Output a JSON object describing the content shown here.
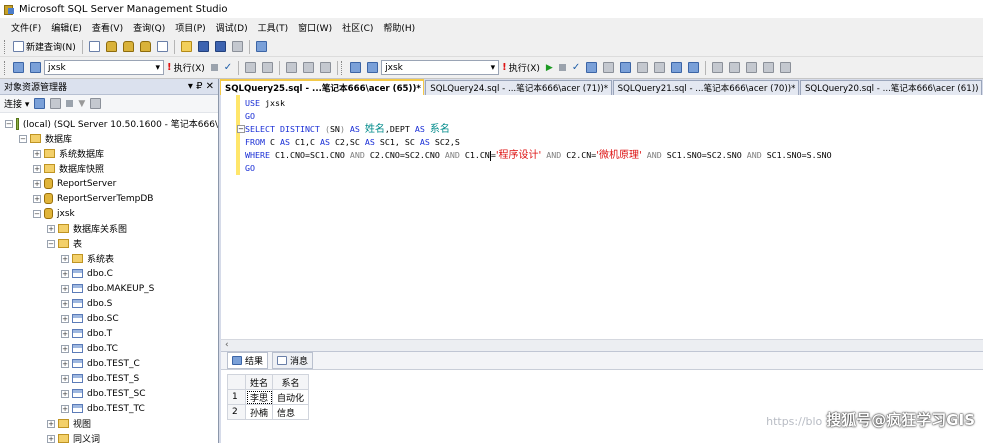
{
  "window": {
    "title": "Microsoft SQL Server Management Studio"
  },
  "menu": [
    "文件(F)",
    "编辑(E)",
    "查看(V)",
    "查询(Q)",
    "项目(P)",
    "调试(D)",
    "工具(T)",
    "窗口(W)",
    "社区(C)",
    "帮助(H)"
  ],
  "toolbar1": {
    "new_query": "新建查询(N)"
  },
  "toolbar2": {
    "db_left": "jxsk",
    "execute_left": "执行(X)",
    "db_right": "jxsk",
    "execute_right": "执行(X)"
  },
  "explorer": {
    "title": "对象资源管理器",
    "pin": "▾ ₽ ✕",
    "connect": "连接 ▾",
    "tree": [
      {
        "label": "(local) (SQL Server 10.50.1600 - 笔记本666\\",
        "indent": 0,
        "exp": "⊟",
        "icon": "server"
      },
      {
        "label": "数据库",
        "indent": 1,
        "exp": "⊟",
        "icon": "folder"
      },
      {
        "label": "系统数据库",
        "indent": 2,
        "exp": "⊞",
        "icon": "folder"
      },
      {
        "label": "数据库快照",
        "indent": 2,
        "exp": "⊞",
        "icon": "folder"
      },
      {
        "label": "ReportServer",
        "indent": 2,
        "exp": "⊞",
        "icon": "db"
      },
      {
        "label": "ReportServerTempDB",
        "indent": 2,
        "exp": "⊞",
        "icon": "db"
      },
      {
        "label": "jxsk",
        "indent": 2,
        "exp": "⊟",
        "icon": "db"
      },
      {
        "label": "数据库关系图",
        "indent": 3,
        "exp": "⊞",
        "icon": "folder"
      },
      {
        "label": "表",
        "indent": 3,
        "exp": "⊟",
        "icon": "folder"
      },
      {
        "label": "系统表",
        "indent": 4,
        "exp": "⊞",
        "icon": "folder"
      },
      {
        "label": "dbo.C",
        "indent": 4,
        "exp": "⊞",
        "icon": "table"
      },
      {
        "label": "dbo.MAKEUP_S",
        "indent": 4,
        "exp": "⊞",
        "icon": "table"
      },
      {
        "label": "dbo.S",
        "indent": 4,
        "exp": "⊞",
        "icon": "table"
      },
      {
        "label": "dbo.SC",
        "indent": 4,
        "exp": "⊞",
        "icon": "table"
      },
      {
        "label": "dbo.T",
        "indent": 4,
        "exp": "⊞",
        "icon": "table"
      },
      {
        "label": "dbo.TC",
        "indent": 4,
        "exp": "⊞",
        "icon": "table"
      },
      {
        "label": "dbo.TEST_C",
        "indent": 4,
        "exp": "⊞",
        "icon": "table"
      },
      {
        "label": "dbo.TEST_S",
        "indent": 4,
        "exp": "⊞",
        "icon": "table"
      },
      {
        "label": "dbo.TEST_SC",
        "indent": 4,
        "exp": "⊞",
        "icon": "table"
      },
      {
        "label": "dbo.TEST_TC",
        "indent": 4,
        "exp": "⊞",
        "icon": "table"
      },
      {
        "label": "视图",
        "indent": 3,
        "exp": "⊞",
        "icon": "folder"
      },
      {
        "label": "同义词",
        "indent": 3,
        "exp": "⊞",
        "icon": "folder"
      }
    ]
  },
  "tabs": [
    "SQLQuery25.sql - ...笔记本666\\acer (65))*",
    "SQLQuery24.sql - ...笔记本666\\acer (71))*",
    "SQLQuery21.sql - ...笔记本666\\acer (70))*",
    "SQLQuery20.sql - ...笔记本666\\acer (61))"
  ],
  "editor": {
    "lines": [
      [
        [
          "kw",
          "USE "
        ],
        [
          "plain",
          "jxsk"
        ]
      ],
      [
        [
          "kw",
          "GO"
        ]
      ],
      [
        [
          "kw",
          "SELECT DISTINCT "
        ],
        [
          "gray",
          "("
        ],
        [
          "plain",
          "SN"
        ],
        [
          "gray",
          ")"
        ],
        [
          "kw",
          " AS "
        ],
        [
          "cn",
          "姓名"
        ],
        [
          "plain",
          ",DEPT"
        ],
        [
          "kw",
          " AS "
        ],
        [
          "cn",
          "系名"
        ]
      ],
      [
        [
          "kw",
          "FROM "
        ],
        [
          "plain",
          "C"
        ],
        [
          "kw",
          " AS "
        ],
        [
          "plain",
          "C1,C"
        ],
        [
          "kw",
          " AS "
        ],
        [
          "plain",
          "C2,SC"
        ],
        [
          "kw",
          " AS "
        ],
        [
          "plain",
          "SC1, SC"
        ],
        [
          "kw",
          " AS "
        ],
        [
          "plain",
          "SC2,S"
        ]
      ],
      [
        [
          "kw",
          "WHERE "
        ],
        [
          "plain",
          "C1.CNO=SC1.CNO "
        ],
        [
          "gray",
          "AND "
        ],
        [
          "plain",
          "C2.CNO=SC2.CNO "
        ],
        [
          "gray",
          "AND "
        ],
        [
          "plain",
          "C1.CN"
        ],
        [
          "caret",
          ""
        ],
        [
          "plain",
          "="
        ],
        [
          "str",
          "'程序设计'"
        ],
        [
          "gray",
          " AND "
        ],
        [
          "plain",
          "C2.CN="
        ],
        [
          "str",
          "'微机原理'"
        ],
        [
          "gray",
          " AND "
        ],
        [
          "plain",
          "SC1.SNO=SC2.SNO "
        ],
        [
          "gray",
          "AND "
        ],
        [
          "plain",
          "SC1.SNO=S.SNO"
        ]
      ],
      [
        [
          "kw",
          "GO"
        ]
      ]
    ]
  },
  "results": {
    "tab_results": "结果",
    "tab_messages": "消息",
    "columns": [
      "姓名",
      "系名"
    ],
    "rows": [
      [
        "1",
        "李思",
        "自动化"
      ],
      [
        "2",
        "孙楠",
        "信息"
      ]
    ]
  },
  "watermark": {
    "url": "https://blo",
    "brand": "搜狐号@疯狂学习GIS"
  }
}
